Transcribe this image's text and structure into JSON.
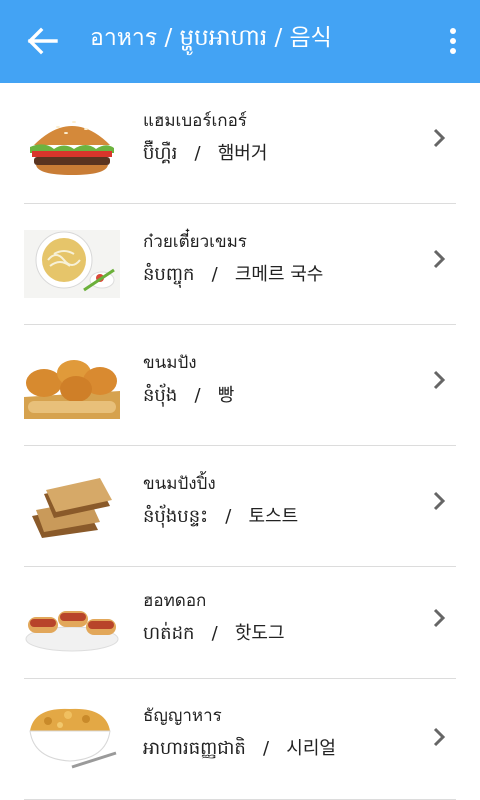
{
  "appbar": {
    "title": "อาหาร / ម្ហូបអាហារ / 음식",
    "back_icon": "arrow-left-icon",
    "menu_icon": "more-vert-icon",
    "color": "#43a3f4"
  },
  "items": [
    {
      "thai": "แฮมเบอร์เกอร์",
      "khmer": "ប៊ឺហ្គឺរ",
      "korean": "햄버거",
      "image": "hamburger"
    },
    {
      "thai": "ก๋วยเตี๋ยวเขมร",
      "khmer": "នំបញ្ចុក",
      "korean": "크메르 국수",
      "image": "khmer-noodles"
    },
    {
      "thai": "ขนมปัง",
      "khmer": "នំប៉័ង",
      "korean": "빵",
      "image": "bread"
    },
    {
      "thai": "ขนมปังปิ้ง",
      "khmer": "នំប៉័ងបន្ទះ",
      "korean": "토스트",
      "image": "toast"
    },
    {
      "thai": "ฮอทดอก",
      "khmer": "ហត់ដក",
      "korean": "핫도그",
      "image": "hot-dog"
    },
    {
      "thai": "ธัญญาหาร",
      "khmer": "អាហារធញ្ញជាតិ",
      "korean": "시리얼",
      "image": "cereal"
    }
  ],
  "separator": "/"
}
